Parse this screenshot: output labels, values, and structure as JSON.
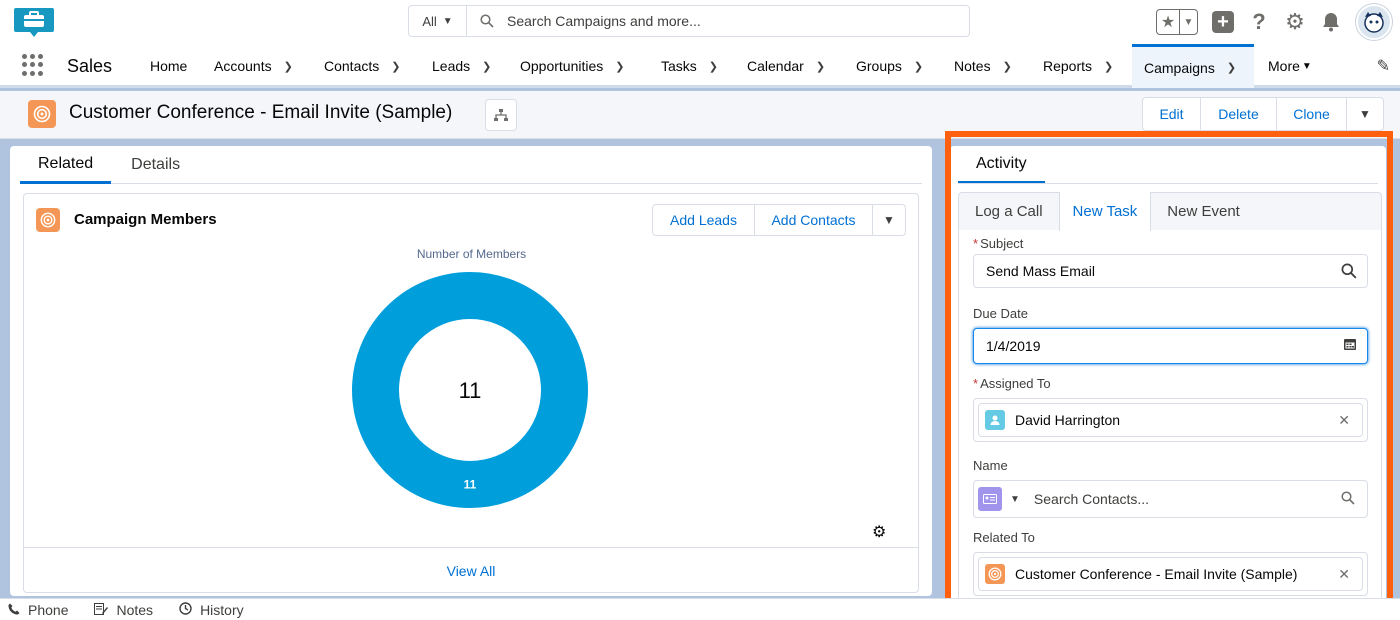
{
  "search": {
    "scope": "All",
    "placeholder": "Search Campaigns and more..."
  },
  "nav": {
    "app_name": "Sales",
    "items": [
      {
        "label": "Home",
        "chevron": false
      },
      {
        "label": "Accounts",
        "chevron": true
      },
      {
        "label": "Contacts",
        "chevron": true
      },
      {
        "label": "Leads",
        "chevron": true
      },
      {
        "label": "Opportunities",
        "chevron": true
      },
      {
        "label": "Tasks",
        "chevron": true
      },
      {
        "label": "Calendar",
        "chevron": true
      },
      {
        "label": "Groups",
        "chevron": true
      },
      {
        "label": "Notes",
        "chevron": true
      },
      {
        "label": "Reports",
        "chevron": true
      },
      {
        "label": "Campaigns",
        "chevron": true,
        "active": true
      },
      {
        "label": "More",
        "chevron": "small"
      }
    ]
  },
  "record": {
    "title": "Customer Conference - Email Invite (Sample)",
    "actions": [
      "Edit",
      "Delete",
      "Clone"
    ]
  },
  "left_tabs": {
    "related": "Related",
    "details": "Details"
  },
  "campaign_members": {
    "title": "Campaign Members",
    "buttons": [
      "Add Leads",
      "Add Contacts"
    ],
    "chart_title": "Number of Members",
    "view_all": "View All"
  },
  "chart_data": {
    "type": "pie",
    "title": "Number of Members",
    "donut": true,
    "center_label": "11",
    "slices": [
      {
        "label": "11",
        "value": 11,
        "color": "#009fdb"
      }
    ]
  },
  "activity": {
    "tab": "Activity",
    "subtabs": [
      "Log a Call",
      "New Task",
      "New Event"
    ],
    "active_subtab": "New Task",
    "subject_label": "Subject",
    "subject_value": "Send Mass Email",
    "due_date_label": "Due Date",
    "due_date_value": "1/4/2019",
    "assigned_label": "Assigned To",
    "assigned_value": "David Harrington",
    "name_label": "Name",
    "name_placeholder": "Search Contacts...",
    "related_label": "Related To",
    "related_value": "Customer Conference - Email Invite (Sample)"
  },
  "utility_bar": {
    "phone": "Phone",
    "notes": "Notes",
    "history": "History"
  },
  "colors": {
    "brand": "#0070d2",
    "campaign_icon": "#f49756",
    "highlight": "#ff6010",
    "donut": "#009fdb"
  }
}
